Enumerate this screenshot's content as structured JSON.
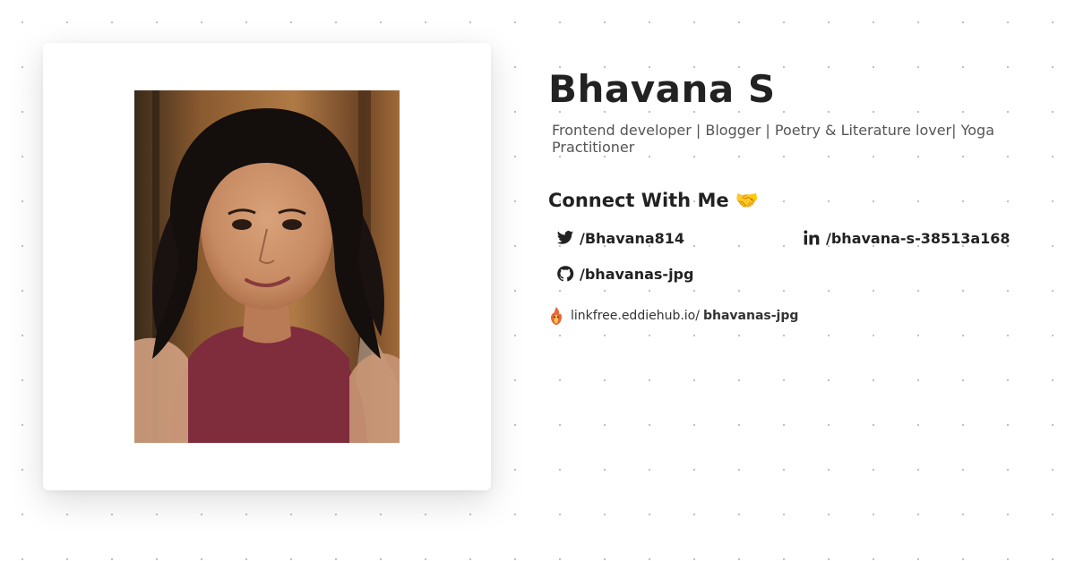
{
  "profile": {
    "name": "Bhavana S",
    "bio": "Frontend developer | Blogger | Poetry & Literature lover| Yoga Practitioner",
    "avatar_alt": "Bhavana S profile photo"
  },
  "connect": {
    "heading": "Connect With Me",
    "emoji": "🤝",
    "links": {
      "twitter": {
        "label": "/Bhavana814",
        "icon": "twitter-icon"
      },
      "linkedin": {
        "label": "/bhavana-s-38513a168",
        "icon": "linkedin-icon"
      },
      "github": {
        "label": "/bhavanas-jpg",
        "icon": "github-icon"
      }
    }
  },
  "linkfree": {
    "prefix": "linkfree.eddiehub.io/",
    "username": "bhavanas-jpg",
    "icon": "linkfree-logo-icon"
  },
  "colors": {
    "text": "#222222",
    "bio_text": "#555555",
    "background": "#ffffff",
    "dot_grid": "#bdbdbd"
  }
}
